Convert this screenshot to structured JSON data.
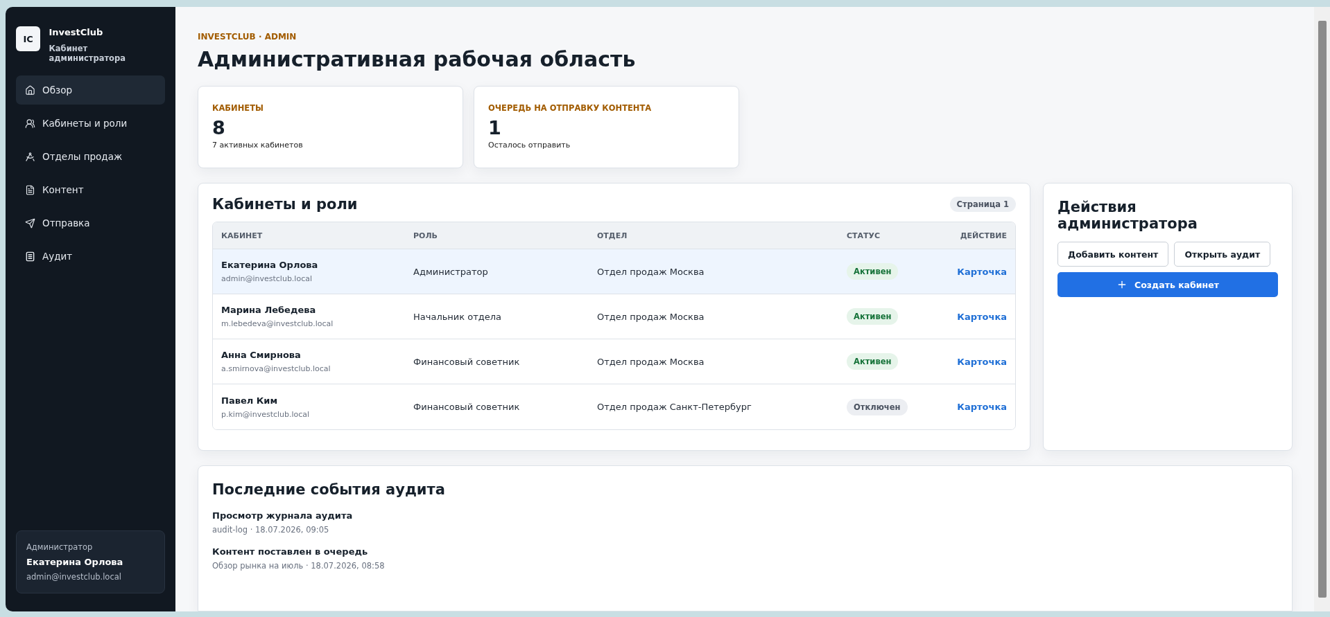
{
  "brand": {
    "logo": "IC",
    "name": "InvestClub",
    "subtitle": "Кабинет администратора"
  },
  "nav": [
    {
      "label": "Обзор",
      "selected": true
    },
    {
      "label": "Кабинеты и роли",
      "selected": false
    },
    {
      "label": "Отделы продаж",
      "selected": false
    },
    {
      "label": "Контент",
      "selected": false
    },
    {
      "label": "Отправка",
      "selected": false
    },
    {
      "label": "Аудит",
      "selected": false
    }
  ],
  "user": {
    "role": "Администратор",
    "name": "Екатерина Орлова",
    "email": "admin@investclub.local"
  },
  "header": {
    "eyebrow": "INVESTCLUB · ADMIN",
    "title": "Административная рабочая область"
  },
  "stats": [
    {
      "label": "КАБИНЕТЫ",
      "value": "8",
      "note": "7 активных кабинетов"
    },
    {
      "label": "ОЧЕРЕДЬ НА ОТПРАВКУ КОНТЕНТА",
      "value": "1",
      "note": "Осталось отправить"
    }
  ],
  "table": {
    "title": "Кабинеты и роли",
    "page": "Страница 1",
    "columns": [
      "КАБИНЕТ",
      "РОЛЬ",
      "ОТДЕЛ",
      "СТАТУС",
      "ДЕЙСТВИЕ"
    ],
    "rows": [
      {
        "name": "Екатерина Орлова",
        "email": "admin@investclub.local",
        "role": "Администратор",
        "department": "Отдел продаж Москва",
        "status": {
          "label": "Активен",
          "kind": "active"
        },
        "action": "Карточка",
        "selected": true
      },
      {
        "name": "Марина Лебедева",
        "email": "m.lebedeva@investclub.local",
        "role": "Начальник отдела",
        "department": "Отдел продаж Москва",
        "status": {
          "label": "Активен",
          "kind": "active"
        },
        "action": "Карточка",
        "selected": false
      },
      {
        "name": "Анна Смирнова",
        "email": "a.smirnova@investclub.local",
        "role": "Финансовый советник",
        "department": "Отдел продаж Москва",
        "status": {
          "label": "Активен",
          "kind": "active"
        },
        "action": "Карточка",
        "selected": false
      },
      {
        "name": "Павел Ким",
        "email": "p.kim@investclub.local",
        "role": "Финансовый советник",
        "department": "Отдел продаж Санкт-Петербург",
        "status": {
          "label": "Отключен",
          "kind": "disabled"
        },
        "action": "Карточка",
        "selected": false
      }
    ]
  },
  "actions": {
    "title": "Действия администратора",
    "buttons": [
      {
        "label": "Добавить контент",
        "kind": "secondary"
      },
      {
        "label": "Открыть аудит",
        "kind": "secondary"
      },
      {
        "label": "Создать кабинет",
        "kind": "primary"
      }
    ]
  },
  "audit": {
    "title": "Последние события аудита",
    "events": [
      {
        "title": "Просмотр журнала аудита",
        "meta": "audit-log · 18.07.2026, 09:05"
      },
      {
        "title": "Контент поставлен в очередь",
        "meta": "Обзор рынка на июль · 18.07.2026, 08:58"
      }
    ]
  }
}
